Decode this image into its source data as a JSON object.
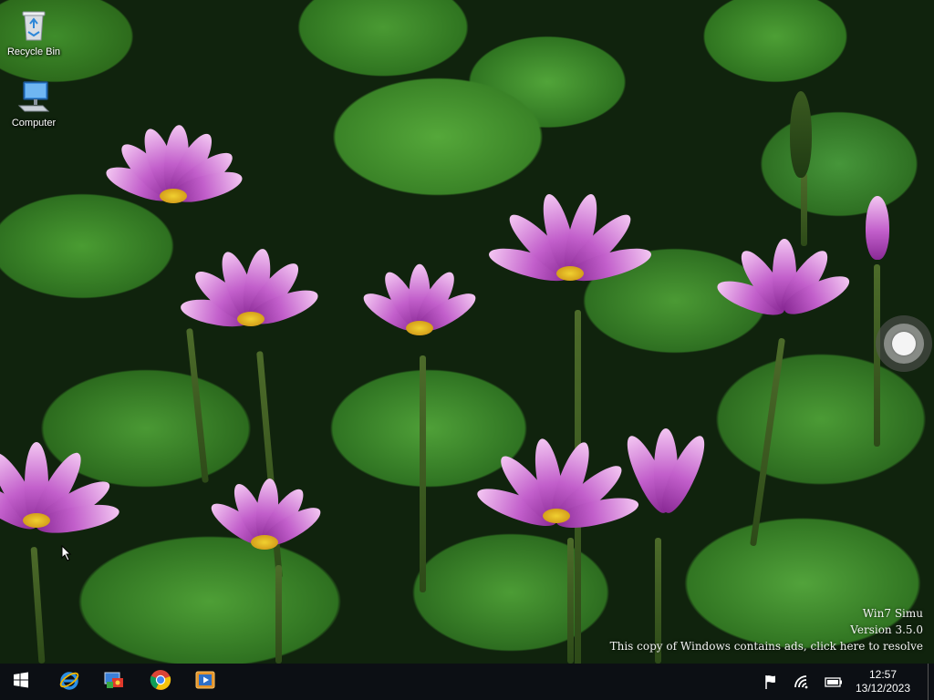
{
  "desktop": {
    "icons": [
      {
        "label": "Recycle Bin",
        "icon": "recycle-bin-icon"
      },
      {
        "label": "Computer",
        "icon": "computer-icon"
      }
    ]
  },
  "watermark": {
    "line1": "Win7 Simu",
    "line2": "Version 3.5.0",
    "line3": "This copy of Windows contains ads, click here to resolve"
  },
  "taskbar": {
    "start_icon": "windows-start-icon",
    "pinned": [
      {
        "icon": "internet-explorer-icon"
      },
      {
        "icon": "control-panel-icon"
      },
      {
        "icon": "chrome-icon"
      },
      {
        "icon": "media-player-icon"
      }
    ],
    "tray": {
      "icons": [
        "action-center-flag-icon",
        "wifi-icon",
        "battery-icon"
      ],
      "time": "12:57",
      "date": "13/12/2023"
    }
  },
  "colors": {
    "taskbar_bg": "#0c0f14",
    "flower_pink": "#c25fcb",
    "leaf_green": "#4a9c32"
  }
}
